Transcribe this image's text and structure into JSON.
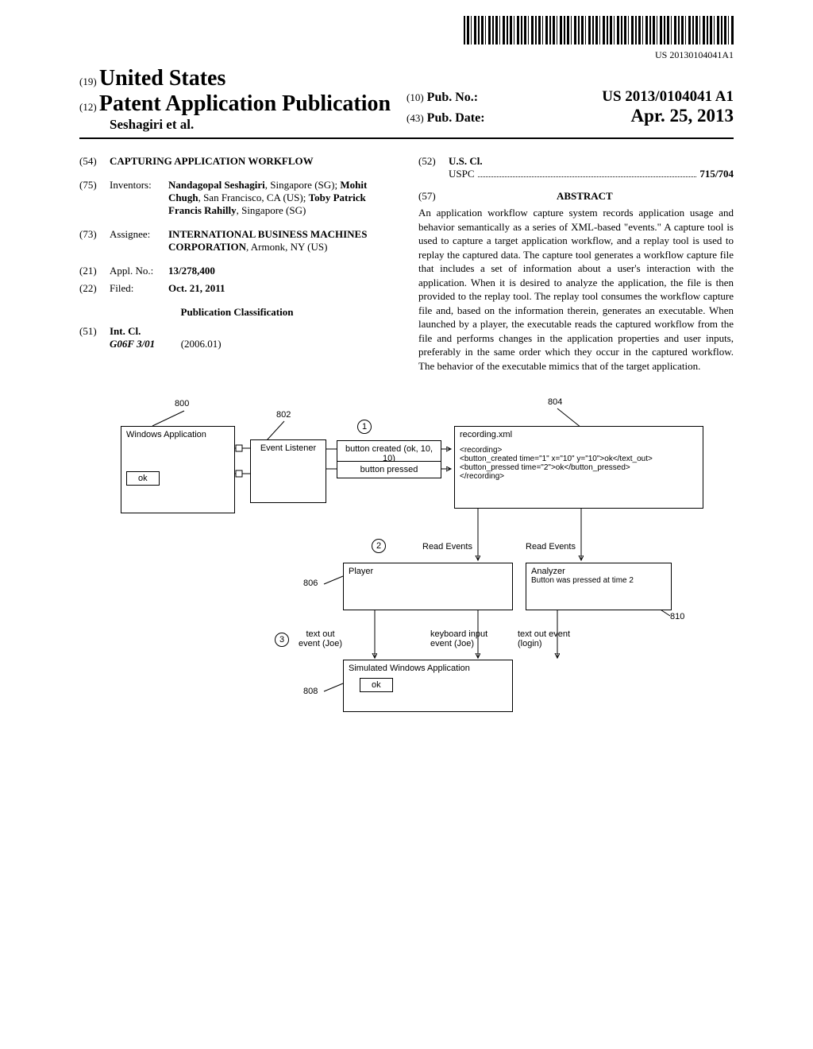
{
  "barcode_number": "US 20130104041A1",
  "header": {
    "code19": "(19)",
    "country": "United States",
    "code12": "(12)",
    "pub_type": "Patent Application Publication",
    "authors_line": "Seshagiri et al.",
    "code10": "(10)",
    "pub_no_label": "Pub. No.:",
    "pub_no": "US 2013/0104041 A1",
    "code43": "(43)",
    "pub_date_label": "Pub. Date:",
    "pub_date": "Apr. 25, 2013"
  },
  "left": {
    "f54": {
      "num": "(54)",
      "title": "CAPTURING APPLICATION WORKFLOW"
    },
    "f75": {
      "num": "(75)",
      "label": "Inventors:",
      "val": "Nandagopal Seshagiri, Singapore (SG); Mohit Chugh, San Francisco, CA (US); Toby Patrick Francis Rahilly, Singapore (SG)"
    },
    "f73": {
      "num": "(73)",
      "label": "Assignee:",
      "val": "INTERNATIONAL BUSINESS MACHINES CORPORATION, Armonk, NY (US)"
    },
    "f21": {
      "num": "(21)",
      "label": "Appl. No.:",
      "val": "13/278,400"
    },
    "f22": {
      "num": "(22)",
      "label": "Filed:",
      "val": "Oct. 21, 2011"
    },
    "pub_class": "Publication Classification",
    "f51": {
      "num": "(51)",
      "label": "Int. Cl.",
      "code": "G06F 3/01",
      "edition": "(2006.01)"
    }
  },
  "right": {
    "f52": {
      "num": "(52)",
      "label": "U.S. Cl.",
      "uspc_label": "USPC",
      "uspc": "715/704"
    },
    "f57_num": "(57)",
    "abstract_label": "ABSTRACT",
    "abstract": "An application workflow capture system records application usage and behavior semantically as a series of XML-based \"events.\" A capture tool is used to capture a target application workflow, and a replay tool is used to replay the captured data. The capture tool generates a workflow capture file that includes a set of information about a user's interaction with the application. When it is desired to analyze the application, the file is then provided to the replay tool. The replay tool consumes the workflow capture file and, based on the information therein, generates an executable. When launched by a player, the executable reads the captured workflow from the file and performs changes in the application properties and user inputs, preferably in the same order which they occur in the captured workflow. The behavior of the executable mimics that of the target application."
  },
  "figure": {
    "ref_800": "800",
    "ref_802": "802",
    "ref_804": "804",
    "ref_806": "806",
    "ref_808": "808",
    "ref_810": "810",
    "win_app": "Windows Application",
    "ok": "ok",
    "event_listener": "Event Listener",
    "btn_created": "button created (ok, 10, 10)",
    "btn_pressed": "button pressed",
    "recording_file": "recording.xml",
    "xml1": "<recording>",
    "xml2": "<button_created time=\"1\" x=\"10\" y=\"10\">ok</text_out>",
    "xml3": "<button_pressed time=\"2\">ok</button_pressed>",
    "xml4": "</recording>",
    "read_events": "Read Events",
    "player": "Player",
    "analyzer": "Analyzer",
    "analyzer_txt": "Button was pressed at time 2",
    "text_out": "text out\nevent (Joe)",
    "kb_input": "keyboard input\nevent (Joe)",
    "text_out_evt": "text out event\n(login)",
    "sim_app": "Simulated Windows Application",
    "step1": "1",
    "step2": "2",
    "step3": "3"
  }
}
